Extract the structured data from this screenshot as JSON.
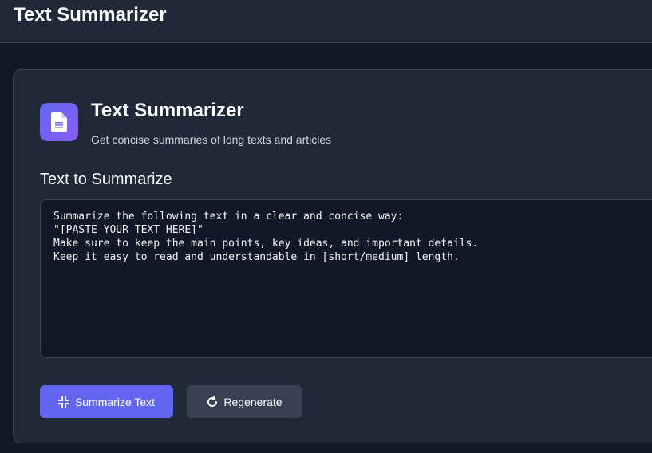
{
  "header": {
    "title": "Text Summarizer"
  },
  "tool": {
    "icon": "document-icon",
    "title": "Text Summarizer",
    "subtitle": "Get concise summaries of long texts and articles"
  },
  "input": {
    "label": "Text to Summarize",
    "value": "Summarize the following text in a clear and concise way:\n\"[PASTE YOUR TEXT HERE]\"\nMake sure to keep the main points, key ideas, and important details.\nKeep it easy to read and understandable in [short/medium] length."
  },
  "actions": {
    "summarize_label": "Summarize Text",
    "summarize_icon": "compress-icon",
    "regenerate_label": "Regenerate",
    "regenerate_icon": "refresh-icon"
  },
  "colors": {
    "accent": "#6366f1",
    "background": "#111827",
    "surface": "#1f2937",
    "border": "#374151"
  }
}
